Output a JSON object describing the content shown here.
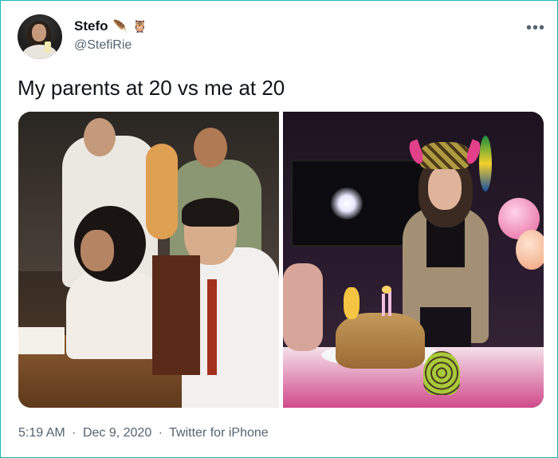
{
  "user": {
    "display_name": "Stefo",
    "handle": "@StefiRie",
    "badges": [
      "🪶",
      "🦉"
    ]
  },
  "tweet": {
    "text": "My parents at 20 vs me at 20"
  },
  "media": {
    "count": 2
  },
  "meta": {
    "time": "5:19 AM",
    "separator": "·",
    "date": "Dec 9, 2020",
    "source": "Twitter for iPhone"
  },
  "actions": {
    "more_label": "•••"
  },
  "colors": {
    "frame_border": "#18b8b8",
    "text_primary": "#0f1419",
    "text_secondary": "#536471"
  }
}
